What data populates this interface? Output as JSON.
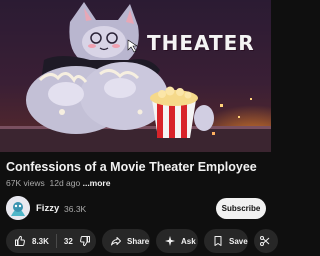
{
  "video": {
    "thumbnail_text": "THEATER",
    "title": "Confessions of a Movie Theater Employee",
    "views": "67K views",
    "age": "12d ago",
    "more_label": "...more"
  },
  "channel": {
    "name": "Fizzy",
    "subscribers": "36.3K",
    "subscribe_label": "Subscribe"
  },
  "actions": {
    "like_count": "8.3K",
    "dislike_count": "32",
    "share_label": "Share",
    "ask_label": "Ask",
    "save_label": "Save"
  },
  "icons": [
    "like-icon",
    "dislike-icon",
    "share-icon",
    "ask-sparkle-icon",
    "save-icon",
    "clip-icon"
  ],
  "colors": {
    "background": "#0f0f0f",
    "pill": "#272727",
    "subscribe_bg": "#f1f1f1",
    "popcorn_red": "#d8242a"
  }
}
